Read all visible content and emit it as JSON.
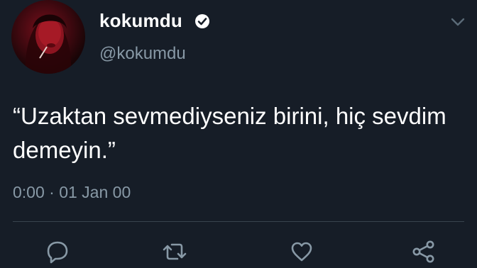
{
  "tweet": {
    "display_name": "kokumdu",
    "handle": "@kokumdu",
    "text": "“Uzaktan sevmediyseniz birini, hiç sevdim demeyin.”",
    "timestamp": "0:00 · 01 Jan 00"
  },
  "icons": {
    "verified": "verified-badge-icon",
    "menu": "chevron-down-icon",
    "reply": "reply-icon",
    "retweet": "retweet-icon",
    "like": "heart-icon",
    "share": "share-icon"
  },
  "colors": {
    "background": "#161d27",
    "text_primary": "#ffffff",
    "text_secondary": "#8899a6",
    "divider": "#38444d",
    "icon": "#8899a6"
  }
}
